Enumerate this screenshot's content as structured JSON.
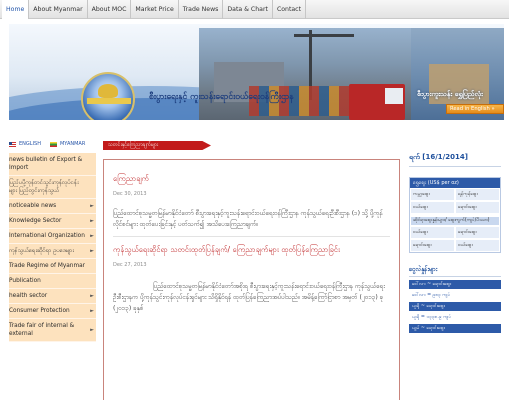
{
  "nav": {
    "items": [
      {
        "label": "Home",
        "active": true
      },
      {
        "label": "About Myanmar",
        "active": false
      },
      {
        "label": "About MOC",
        "active": false
      },
      {
        "label": "Market Price",
        "active": false
      },
      {
        "label": "Trade News",
        "active": false
      },
      {
        "label": "Data & Chart",
        "active": false
      },
      {
        "label": "Contact",
        "active": false
      }
    ]
  },
  "banner": {
    "title": "စီးပွားရေးနှင့် ကူးသန်းရောင်းဝယ်ရေးဝန်ကြီးဌာန",
    "right_text": "စီးပွားကူးသန်း ရွှေပြည်လုံး",
    "read_english": "Read in English »"
  },
  "sidebar": {
    "lang_english": "ENGLISH",
    "lang_myanmar": "MYANMAR",
    "items": [
      {
        "label": "news bulletin of Export & Import",
        "arrow": false
      },
      {
        "label": "ပြည်ပပို့ကုန်တင်သွင်းကုန်လုပ်ငန်းများ ပြည်တွင်းကုန်သွယ်",
        "arrow": false
      },
      {
        "label": "noticeable news",
        "arrow": true
      },
      {
        "label": "Knowledge Sector",
        "arrow": true
      },
      {
        "label": "International Organization",
        "arrow": true
      },
      {
        "label": "ကုန်သွယ်ရေးဆိုင်ရာ ဥပဒေများ",
        "arrow": true
      },
      {
        "label": "Trade Regime of Myanmar",
        "arrow": false
      },
      {
        "label": "Publication",
        "arrow": false
      },
      {
        "label": "health sector",
        "arrow": true
      },
      {
        "label": "Consumer Protection",
        "arrow": true
      },
      {
        "label": "Trade fair of internal & external",
        "arrow": true
      }
    ]
  },
  "main": {
    "section_title": "သတင်းနှင့်ကြေညာချက်များ",
    "news": [
      {
        "title": "ကြေညာချက်",
        "date": "Dec 30, 2013",
        "text": "ပြည်ထောင်စုသမ္မတမြန်မာနိုင်ငံတော် စီးပွားရေးနှင့်ကူးသန်းရောင်းဝယ်ရေးဝန်ကြီးဌာန ကုန်သွယ်ရေးဦးစီးဌာန (၁) သို့ ပို့ကုန်လိုင်စင်များ ထုတ်ပေးခြင်းနှင့် ပတ်သက်၍ အသိပေးကြေညာချက်။"
      },
      {
        "title": "ကုန်သွယ်ရေးဆိုင်ရာ သတင်းထုတ်ပြန်ချက်/ ကြေညာချက်များ ထုတ်ပြန်ကြေညာခြင်း",
        "date": "Dec 27, 2013",
        "text": "ပြည်ထောင်စုသမ္မတမြန်မာနိုင်ငံတော်အစိုးရ စီးပွားရေးနှင့်ကူးသန်းရောင်းဝယ်ရေးဝန်ကြီးဌာန ကုန်သွယ်ရေးဦးစီးဌာနက ပို့ကုန်သွင်းကုန်လုပ်ငန်းရှင်များ သိရှိနိုင်ရန် ထုတ်ပြန်ကြေညာအပ်ပါသည်။ အမိန့်ကြော်ငြာစာ အမှတ် (၂၀၁၃) ခု (၂၀၁၃) ခုနှစ်"
      }
    ]
  },
  "right": {
    "date_title": "ရက် [16/1/2014]",
    "gold_panel": {
      "header": "ရွှေဈေး (US$ per oz)",
      "rows": [
        [
          "ကမ္ဘာ့ဈေး",
          "ရန်ကုန်ဈေး"
        ],
        [
          "ဝယ်ဈေး",
          "ရောင်းဈေး"
        ],
        [
          "",
          ""
        ]
      ],
      "subheader": "ဆိုင်ရာဈေးနှုန်းများ/ ဈေးကွက်(ကျပ်/ပိဿာ)",
      "rows2": [
        [
          "ဝယ်ဈေး",
          "ရောင်းဈေး"
        ],
        [
          "ရောင်းဈေး",
          "ဝယ်ဈေး"
        ]
      ]
    },
    "exchange_title": "ငွေလဲနှုန်းများ",
    "rates": [
      "ဒေါ်လာ ~ ရောင်းဈေး",
      "ဒေါ်လာ = ၉၈၃ ကျပ်",
      "ယူရို ~ ရောင်းဈေး",
      "ယူရို = ၁၃၃၈.၉ ကျပ်",
      "ယွမ် ~ ရောင်းဈေး"
    ]
  },
  "colors": {
    "accent_red": "#c21b1b",
    "accent_blue": "#2d5aa8",
    "menu_bg": "#fde2be"
  }
}
